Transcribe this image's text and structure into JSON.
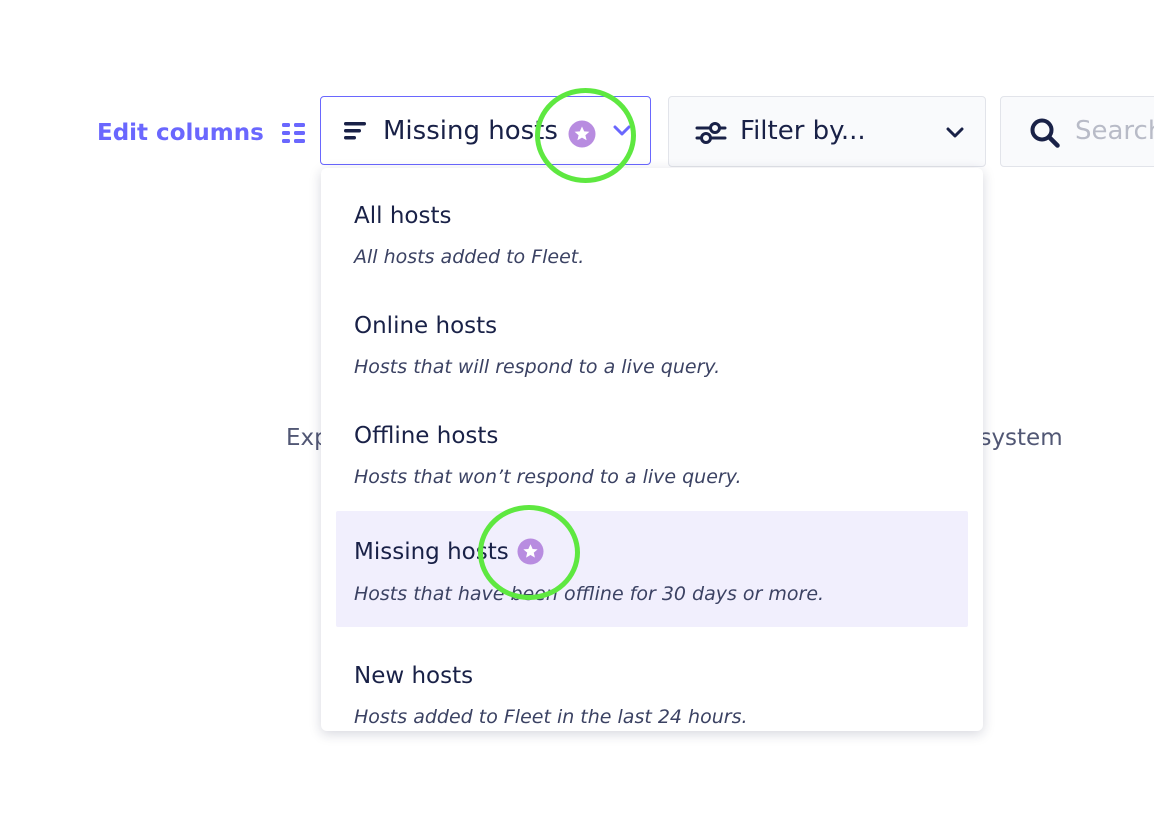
{
  "toolbar": {
    "edit_columns_label": "Edit columns",
    "edit_columns_icon": "grid-icon",
    "status_filter": {
      "selected_label": "Missing hosts",
      "icon": "lines-icon",
      "badge_icon": "premium-star-icon",
      "chevron_icon": "chevron-down-icon"
    },
    "label_filter": {
      "label": "Filter by...",
      "icon": "sliders-icon",
      "chevron_icon": "chevron-down-icon"
    },
    "search": {
      "placeholder": "Search",
      "icon": "search-icon"
    }
  },
  "background": {
    "left_text": "Exp",
    "right_text": "e system"
  },
  "menu": {
    "items": [
      {
        "title": "All hosts",
        "description": "All hosts added to Fleet.",
        "premium": false,
        "selected": false
      },
      {
        "title": "Online hosts",
        "description": "Hosts that will respond to a live query.",
        "premium": false,
        "selected": false
      },
      {
        "title": "Offline hosts",
        "description": "Hosts that won’t respond to a live query.",
        "premium": false,
        "selected": false
      },
      {
        "title": "Missing hosts",
        "description": "Hosts that have been offline for 30 days or more.",
        "premium": true,
        "selected": true
      },
      {
        "title": "New hosts",
        "description": "Hosts added to Fleet in the last 24 hours.",
        "premium": false,
        "selected": false
      }
    ]
  },
  "colors": {
    "accent": "#6a67fe",
    "premium_badge": "#b88ce0",
    "highlight_circle": "#5ee840",
    "selected_row": "#f1effd",
    "text_primary": "#192147"
  }
}
